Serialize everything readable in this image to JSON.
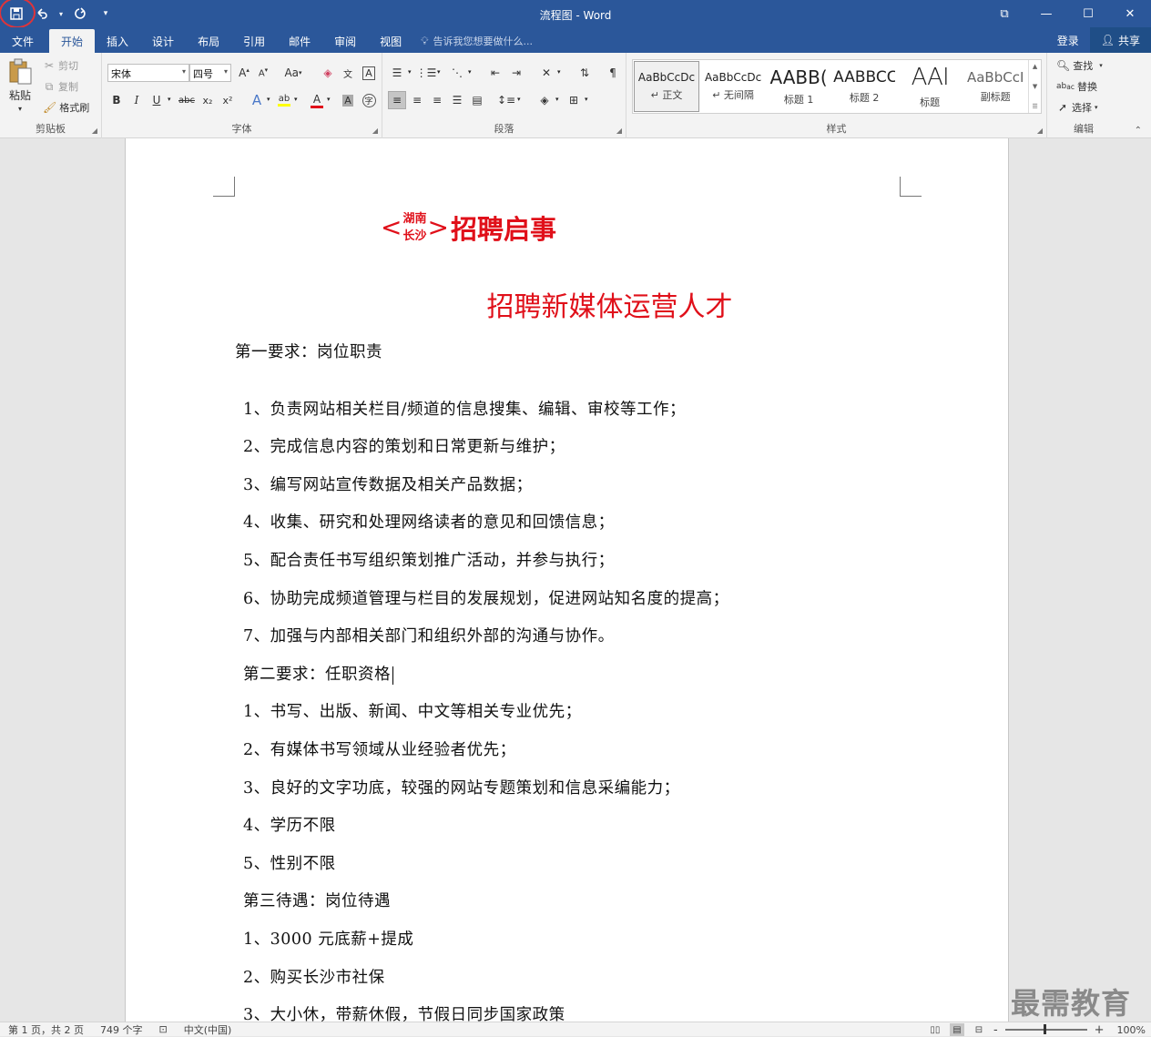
{
  "window": {
    "title": "流程图 - Word",
    "minimize": "—",
    "restore": "☐",
    "close": "✕",
    "ribbon_display": "⧉"
  },
  "qat": {
    "save_icon": "save-icon",
    "undo_icon": "undo-icon",
    "redo_icon": "redo-icon",
    "customize_icon": "customize-icon"
  },
  "tabs": [
    {
      "label": "文件"
    },
    {
      "label": "开始"
    },
    {
      "label": "插入"
    },
    {
      "label": "设计"
    },
    {
      "label": "布局"
    },
    {
      "label": "引用"
    },
    {
      "label": "邮件"
    },
    {
      "label": "审阅"
    },
    {
      "label": "视图"
    }
  ],
  "tellme": {
    "placeholder": "告诉我您想要做什么..."
  },
  "account": {
    "signin": "登录",
    "share": "共享"
  },
  "clipboard": {
    "paste": "粘贴",
    "cut": "剪切",
    "copy": "复制",
    "format_painter": "格式刷",
    "group_label": "剪贴板"
  },
  "font": {
    "font_name": "宋体",
    "font_size": "四号",
    "bold": "B",
    "italic": "I",
    "underline": "U",
    "strikethrough": "abc",
    "subscript": "x₂",
    "superscript": "x²",
    "change_case": "Aa",
    "group_label": "字体",
    "font_color": "#e0101a",
    "highlight_color": "#ffff00"
  },
  "paragraph": {
    "group_label": "段落"
  },
  "styles": {
    "items": [
      {
        "preview": "AaBbCcDc",
        "name": "↵ 正文"
      },
      {
        "preview": "AaBbCcDc",
        "name": "↵ 无间隔"
      },
      {
        "preview": "AABB(",
        "name": "标题 1"
      },
      {
        "preview": "AABBCC",
        "name": "标题 2"
      },
      {
        "preview": "AAI",
        "name": "标题"
      },
      {
        "preview": "AaBbCcI",
        "name": "副标题"
      }
    ],
    "group_label": "样式"
  },
  "editing": {
    "find": "查找",
    "replace": "替换",
    "select": "选择",
    "group_label": "编辑"
  },
  "document": {
    "heading1_left": "<",
    "heading1_top": "湖南",
    "heading1_bottom": "长沙",
    "heading1_right": ">",
    "heading1_main": "招聘启事",
    "heading2": "招聘新媒体运营人才",
    "paragraphs": [
      "第一要求：岗位职责",
      "1、负责网站相关栏目/频道的信息搜集、编辑、审校等工作；",
      "2、完成信息内容的策划和日常更新与维护；",
      "3、编写网站宣传数据及相关产品数据；",
      "4、收集、研究和处理网络读者的意见和回馈信息；",
      "5、配合责任书写组织策划推广活动，并参与执行；",
      "6、协助完成频道管理与栏目的发展规划，促进网站知名度的提高；",
      "7、加强与内部相关部门和组织外部的沟通与协作。",
      "第二要求：任职资格",
      "1、书写、出版、新闻、中文等相关专业优先；",
      "2、有媒体书写领域从业经验者优先；",
      "3、良好的文字功底，较强的网站专题策划和信息采编能力；",
      "4、学历不限",
      "5、性别不限",
      "第三待遇：岗位待遇",
      "1、3000 元底薪+提成",
      "2、购买长沙市社保",
      "3、大小休，带薪休假，节假日同步国家政策"
    ],
    "heading_color": "#e0101a"
  },
  "watermark": "最需教育",
  "status": {
    "page": "第 1 页，共 2 页",
    "words": "749 个字",
    "language": "中文(中国)",
    "zoom": "100%",
    "zoom_minus": "-",
    "zoom_plus": "+"
  }
}
